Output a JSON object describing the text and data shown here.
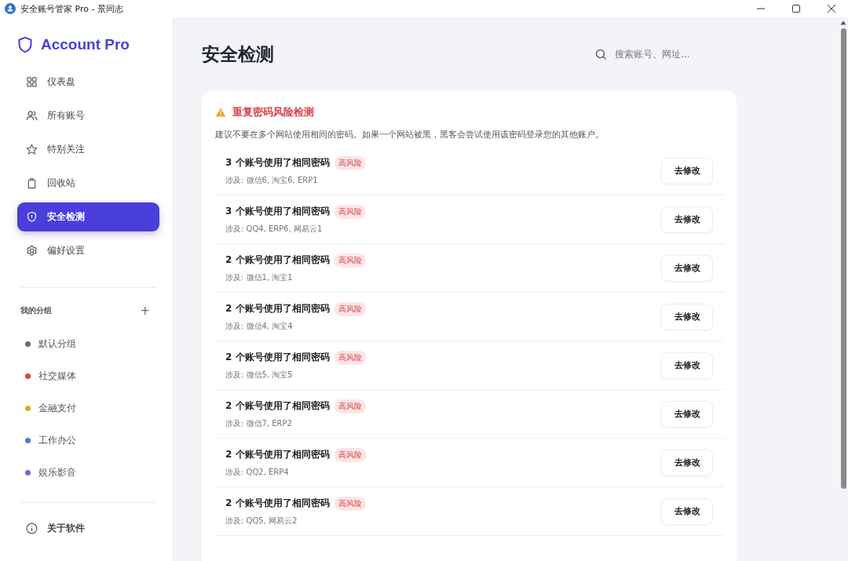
{
  "window": {
    "title": "安全账号管家 Pro - 景同志"
  },
  "sidebar": {
    "brand": "Account Pro",
    "nav": [
      {
        "label": "仪表盘",
        "selected": false
      },
      {
        "label": "所有账号",
        "selected": false
      },
      {
        "label": "特别关注",
        "selected": false
      },
      {
        "label": "回收站",
        "selected": false
      },
      {
        "label": "安全检测",
        "selected": true
      },
      {
        "label": "偏好设置",
        "selected": false
      }
    ],
    "groups_title": "我的分组",
    "groups_add": "+",
    "groups": [
      {
        "label": "默认分组",
        "color": "#6b6b6b"
      },
      {
        "label": "社交媒体",
        "color": "#d9414a"
      },
      {
        "label": "金融支付",
        "color": "#e0a81e"
      },
      {
        "label": "工作办公",
        "color": "#3f7fd9"
      },
      {
        "label": "娱乐影音",
        "color": "#8a5ce0"
      }
    ],
    "about": "关于软件"
  },
  "header": {
    "title": "安全检测",
    "search": {
      "placeholder": "搜索账号、网址..."
    }
  },
  "card": {
    "title": "重复密码风险检测",
    "description": "建议不要在多个网站使用相同的密码。如果一个网站被黑，黑客会尝试使用该密码登录您的其他账户。",
    "rows": [
      {
        "title": "3 个账号使用了相同密码",
        "badge": "高风险",
        "detail": "涉及: 微信6, 淘宝6, ERP1",
        "button": "去修改"
      },
      {
        "title": "3 个账号使用了相同密码",
        "badge": "高风险",
        "detail": "涉及: QQ4, ERP6, 网易云1",
        "button": "去修改"
      },
      {
        "title": "2 个账号使用了相同密码",
        "badge": "高风险",
        "detail": "涉及: 微信1, 淘宝1",
        "button": "去修改"
      },
      {
        "title": "2 个账号使用了相同密码",
        "badge": "高风险",
        "detail": "涉及: 微信4, 淘宝4",
        "button": "去修改"
      },
      {
        "title": "2 个账号使用了相同密码",
        "badge": "高风险",
        "detail": "涉及: 微信5, 淘宝5",
        "button": "去修改"
      },
      {
        "title": "2 个账号使用了相同密码",
        "badge": "高风险",
        "detail": "涉及: 微信7, ERP2",
        "button": "去修改"
      },
      {
        "title": "2 个账号使用了相同密码",
        "badge": "高风险",
        "detail": "涉及: QQ2, ERP4",
        "button": "去修改"
      },
      {
        "title": "2 个账号使用了相同密码",
        "badge": "高风险",
        "detail": "涉及: QQ5, 网易云2",
        "button": "去修改"
      }
    ]
  }
}
